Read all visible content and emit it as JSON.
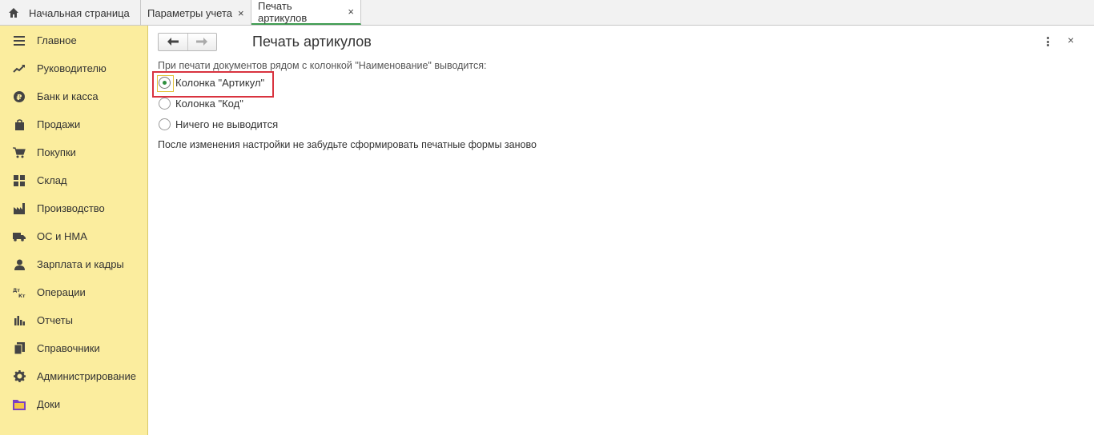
{
  "tabs": {
    "home": {
      "label": "Начальная страница",
      "icon": "home-icon"
    },
    "params": {
      "label": "Параметры учета",
      "close": "×"
    },
    "active": {
      "label": "Печать артикулов",
      "close": "×"
    }
  },
  "sidebar": {
    "items": [
      {
        "label": "Главное",
        "icon": "menu-icon"
      },
      {
        "label": "Руководителю",
        "icon": "trend-icon"
      },
      {
        "label": "Банк и касса",
        "icon": "ruble-icon"
      },
      {
        "label": "Продажи",
        "icon": "bag-icon"
      },
      {
        "label": "Покупки",
        "icon": "cart-icon"
      },
      {
        "label": "Склад",
        "icon": "warehouse-icon"
      },
      {
        "label": "Производство",
        "icon": "factory-icon"
      },
      {
        "label": "ОС и НМА",
        "icon": "truck-icon"
      },
      {
        "label": "Зарплата и кадры",
        "icon": "person-icon"
      },
      {
        "label": "Операции",
        "icon": "dt-kt-icon",
        "icon_text": "Дт Кт"
      },
      {
        "label": "Отчеты",
        "icon": "bar-chart-icon"
      },
      {
        "label": "Справочники",
        "icon": "books-icon"
      },
      {
        "label": "Администрирование",
        "icon": "gear-icon"
      },
      {
        "label": "Доки",
        "icon": "folder-icon"
      }
    ]
  },
  "form": {
    "title": "Печать артикулов",
    "caption": "При печати документов рядом с колонкой \"Наименование\" выводится:",
    "options": [
      {
        "label": "Колонка \"Артикул\"",
        "checked": true
      },
      {
        "label": "Колонка \"Код\"",
        "checked": false
      },
      {
        "label": "Ничего не выводится",
        "checked": false
      }
    ],
    "note": "После изменения настройки не забудьте сформировать печатные формы заново",
    "close": "×"
  },
  "colors": {
    "sidebar_bg": "#fbed9e",
    "accent_green": "#3e9c50",
    "highlight_red": "#d9333f"
  }
}
